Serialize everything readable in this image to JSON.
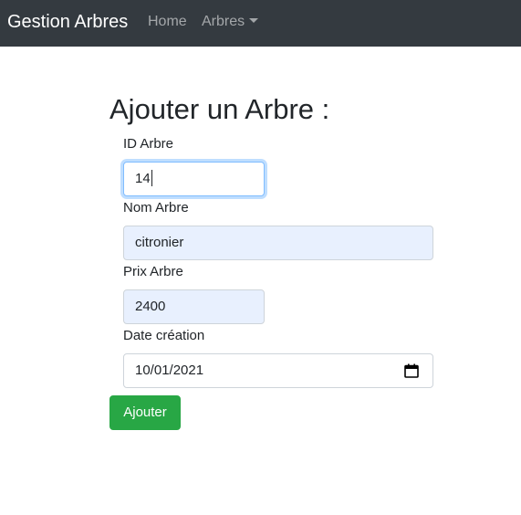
{
  "navbar": {
    "brand": "Gestion Arbres",
    "links": [
      {
        "label": "Home"
      },
      {
        "label": "Arbres"
      }
    ]
  },
  "form": {
    "title": "Ajouter un Arbre :",
    "fields": [
      {
        "label": "ID Arbre",
        "value": "14"
      },
      {
        "label": "Nom Arbre",
        "value": "citronier"
      },
      {
        "label": "Prix Arbre",
        "value": "2400"
      },
      {
        "label": "Date création",
        "value": "10/01/2021"
      }
    ],
    "submit_label": "Ajouter"
  },
  "colors": {
    "navbar_bg": "#343a40",
    "button_bg": "#28a745",
    "autofill_bg": "#e8f0fe",
    "focus_border": "#80bdff"
  },
  "icons": {
    "date_picker": "calendar-icon",
    "dropdown": "caret-down-icon"
  }
}
